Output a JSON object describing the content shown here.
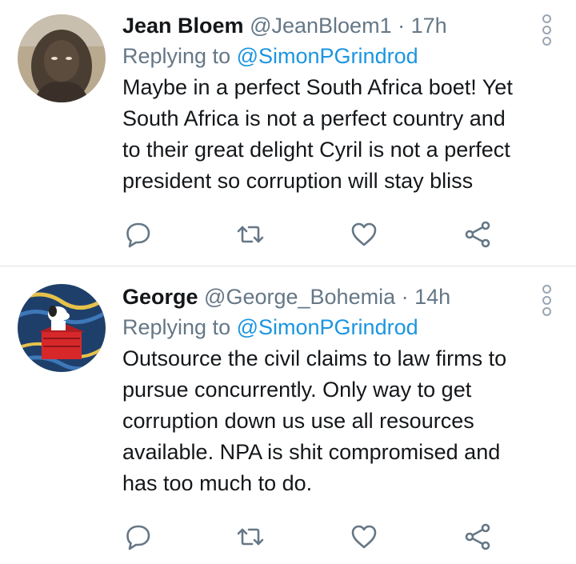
{
  "tweets": [
    {
      "name": "Jean Bloem",
      "handle": "@JeanBloem1",
      "time": "17h",
      "replying_prefix": "Replying to",
      "replying_to": "@SimonPGrindrod",
      "lines": [
        "Maybe in a perfect South Africa boet! Yet",
        "South Africa is not a perfect country and",
        "to their great delight Cyril is not a perfect",
        "president so corruption will stay bliss"
      ]
    },
    {
      "name": "George",
      "handle": "@George_Bohemia",
      "time": "14h",
      "replying_prefix": "Replying to",
      "replying_to": "@SimonPGrindrod",
      "lines": [
        "Outsource the civil claims to law firms to",
        "pursue concurrently. Only way to get",
        "corruption down us use all resources",
        "available. NPA is shit compromised and",
        "has too much to do."
      ]
    }
  ],
  "separator": " · ",
  "icons": [
    "reply-icon",
    "retweet-icon",
    "like-icon",
    "share-icon",
    "more-options-icon"
  ],
  "colors": {
    "mention": "#1b95e0",
    "secondary": "#657786",
    "icon": "#657786",
    "divider": "#dfe3e6"
  }
}
